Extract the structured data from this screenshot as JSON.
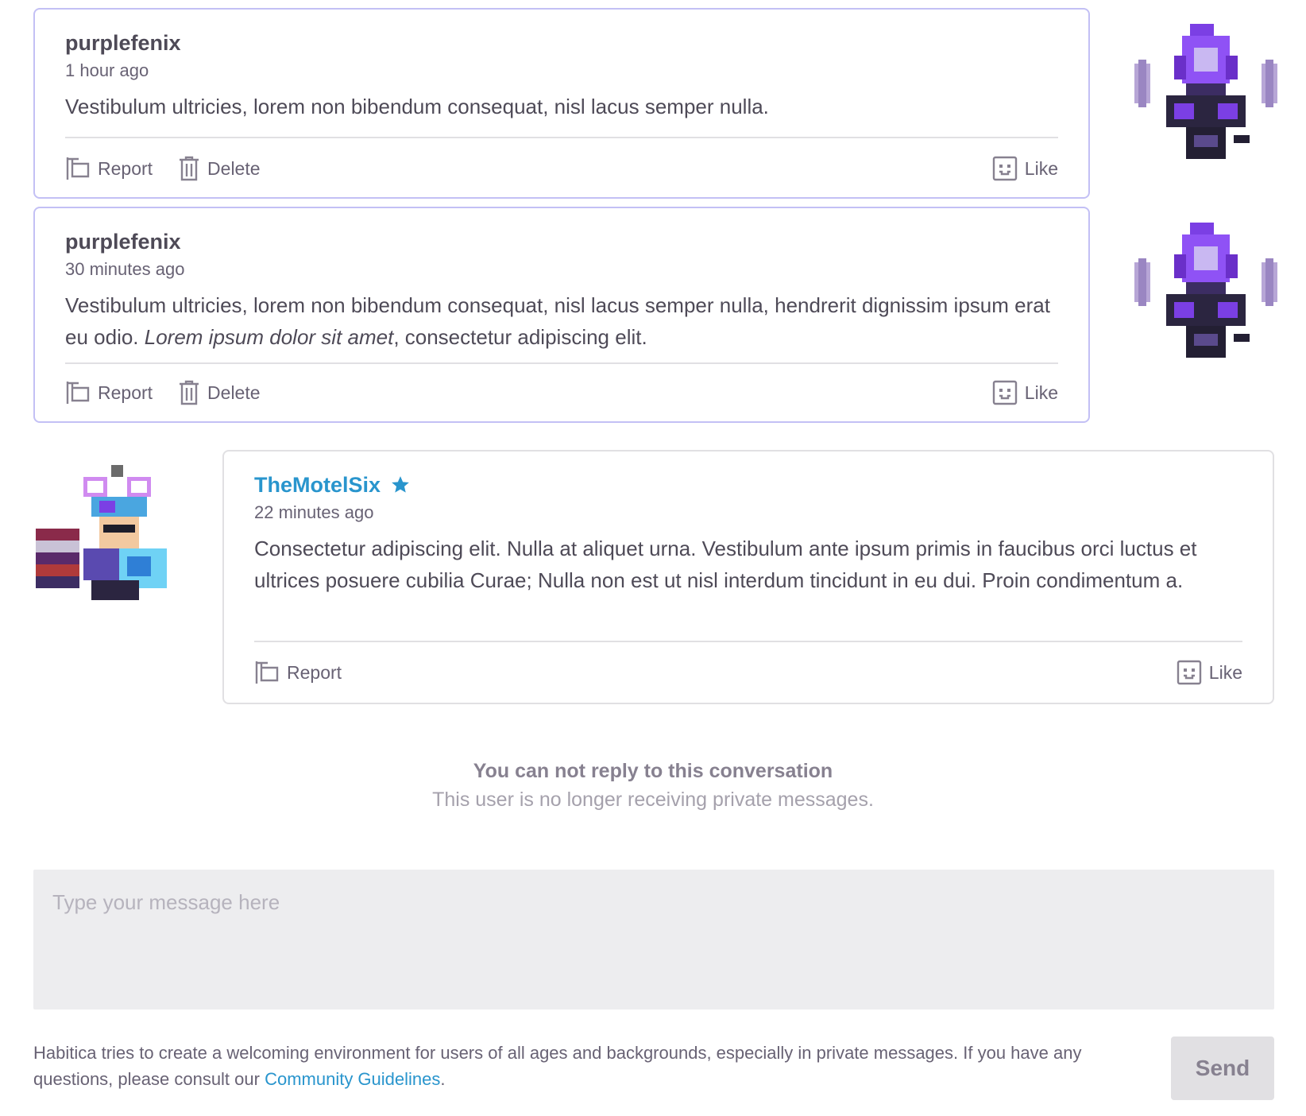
{
  "messages": [
    {
      "username": "purplefenix",
      "time": "1 hour ago",
      "text": "Vestibulum ultricies, lorem non bibendum consequat, nisl lacus semper nulla.",
      "actions": {
        "report": "Report",
        "delete": "Delete",
        "like": "Like"
      }
    },
    {
      "username": "purplefenix",
      "time": "30 minutes ago",
      "text_before": "Vestibulum ultricies, lorem non bibendum consequat, nisl lacus semper nulla, hendrerit dignissim ipsum erat eu odio. ",
      "text_italic": "Lorem ipsum dolor sit amet",
      "text_after": ", consectetur adipiscing elit.",
      "actions": {
        "report": "Report",
        "delete": "Delete",
        "like": "Like"
      }
    },
    {
      "username": "TheMotelSix",
      "time": "22 minutes ago",
      "text": "Consectetur adipiscing elit. Nulla at aliquet urna. Vestibulum ante ipsum primis in faucibus orci luctus et ultrices posuere cubilia Curae; Nulla non est ut nisl interdum tincidunt in eu dui. Proin condimentum a.",
      "actions": {
        "report": "Report",
        "like": "Like"
      }
    }
  ],
  "notice": {
    "title": "You can not reply to this conversation",
    "subtitle": "This user is no longer receiving private messages."
  },
  "composer": {
    "placeholder": "Type your message here",
    "send_label": "Send"
  },
  "footer": {
    "text": "Habitica tries to create a welcoming environment for users of all ages and backgrounds, especially in private messages. If you have any questions, please consult our ",
    "link": "Community Guidelines",
    "end": "."
  },
  "colors": {
    "own_border": "#c3c0f5",
    "other_border": "#e1e0e3",
    "link_blue": "#2995cd",
    "text": "#4e4a57",
    "muted": "#686274"
  },
  "icons": [
    "report-flag-icon",
    "delete-trash-icon",
    "like-face-icon",
    "star-icon",
    "avatar-image"
  ]
}
